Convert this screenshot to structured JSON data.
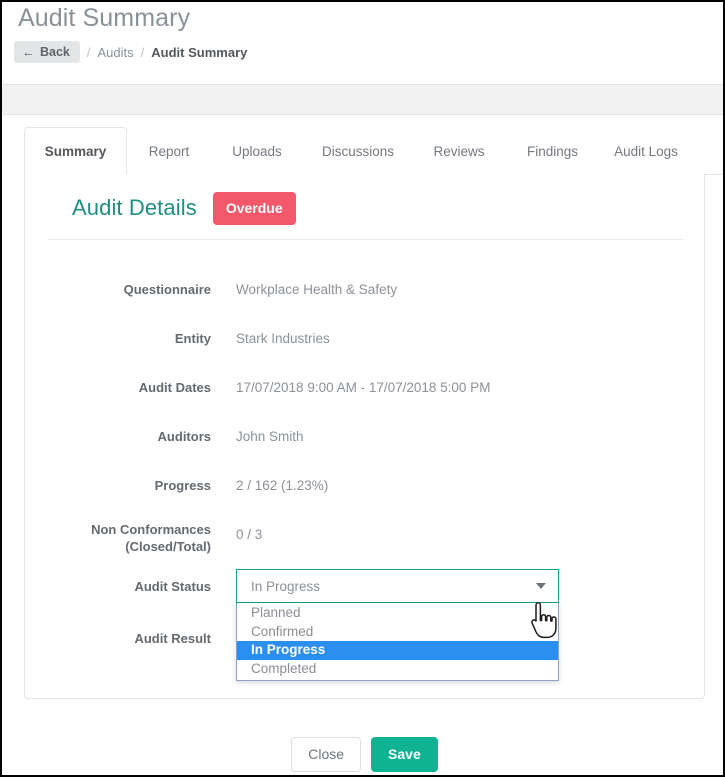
{
  "header": {
    "page_title": "Audit Summary",
    "back_label": "Back",
    "back_icon": "arrow-left-icon",
    "breadcrumb": {
      "separator": "/",
      "items": [
        {
          "label": "Audits",
          "current": false
        },
        {
          "label": "Audit Summary",
          "current": true
        }
      ]
    }
  },
  "tabs": [
    {
      "label": "Summary",
      "active": true
    },
    {
      "label": "Report",
      "active": false
    },
    {
      "label": "Uploads",
      "active": false
    },
    {
      "label": "Discussions",
      "active": false
    },
    {
      "label": "Reviews",
      "active": false
    },
    {
      "label": "Findings",
      "active": false
    },
    {
      "label": "Audit Logs",
      "active": false
    }
  ],
  "card": {
    "title": "Audit Details",
    "status_badge": {
      "label": "Overdue",
      "color": "#f4596b"
    },
    "fields": [
      {
        "label": "Questionnaire",
        "value": "Workplace Health & Safety"
      },
      {
        "label": "Entity",
        "value": "Stark Industries"
      },
      {
        "label": "Audit Dates",
        "value": "17/07/2018 9:00 AM - 17/07/2018 5:00 PM"
      },
      {
        "label": "Auditors",
        "value": "John Smith"
      },
      {
        "label": "Progress",
        "value": "2 / 162 (1.23%)"
      },
      {
        "label_line1": "Non Conformances",
        "label_line2": "(Closed/Total)",
        "value": "0 / 3"
      }
    ],
    "audit_status": {
      "label": "Audit Status",
      "selected": "In Progress",
      "expanded": true,
      "caret_icon": "chevron-down-icon",
      "options": [
        {
          "label": "Planned",
          "selected": false
        },
        {
          "label": "Confirmed",
          "selected": false
        },
        {
          "label": "In Progress",
          "selected": true
        },
        {
          "label": "Completed",
          "selected": false
        }
      ]
    },
    "audit_result": {
      "label": "Audit Result"
    }
  },
  "footer": {
    "close_label": "Close",
    "save_label": "Save",
    "save_color": "#0fb392"
  },
  "cursor": {
    "icon": "pointing-hand-cursor"
  },
  "theme": {
    "title_color": "#1d8f81",
    "accent": "#18a08f",
    "highlight": "#2a8fef"
  }
}
